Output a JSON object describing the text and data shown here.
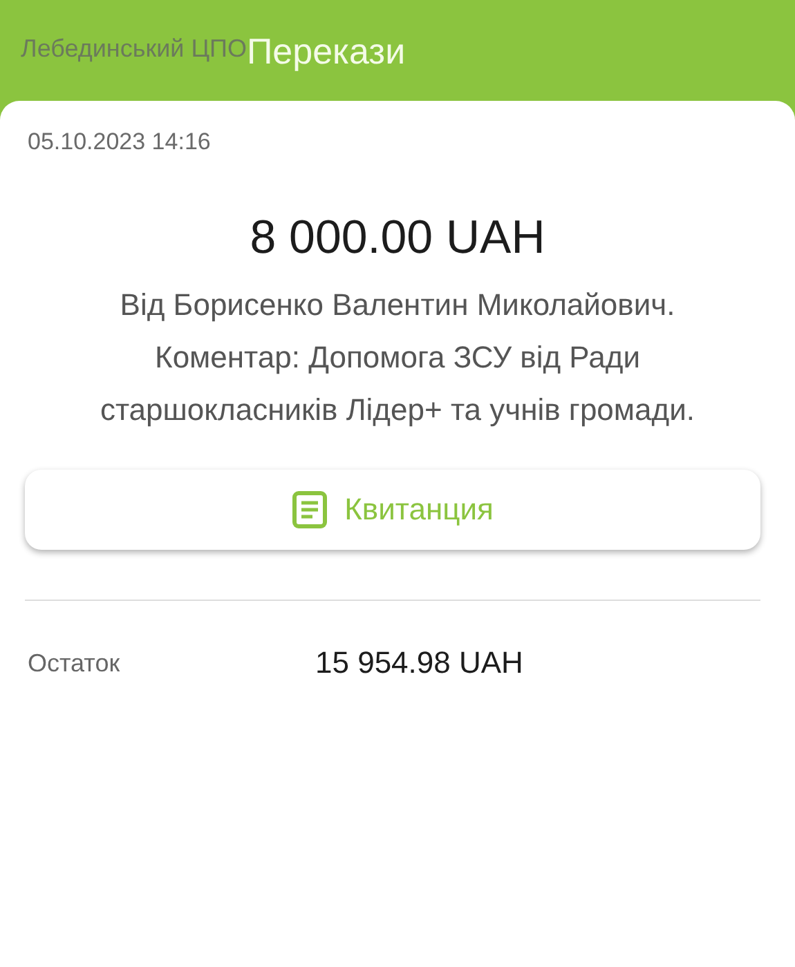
{
  "header": {
    "subtitle": "Лебединський ЦПО",
    "title": "Перекази"
  },
  "transfer": {
    "datetime": "05.10.2023 14:16",
    "amount": "8 000.00 UAH",
    "description": "Від Борисенко Валентин Миколайович. Коментар: Допомога ЗСУ від Ради старшокласників Лідер+ та учнів громади."
  },
  "receipt_button": {
    "label": "Квитанция"
  },
  "balance": {
    "label": "Остаток",
    "value": "15 954.98 UAH"
  }
}
